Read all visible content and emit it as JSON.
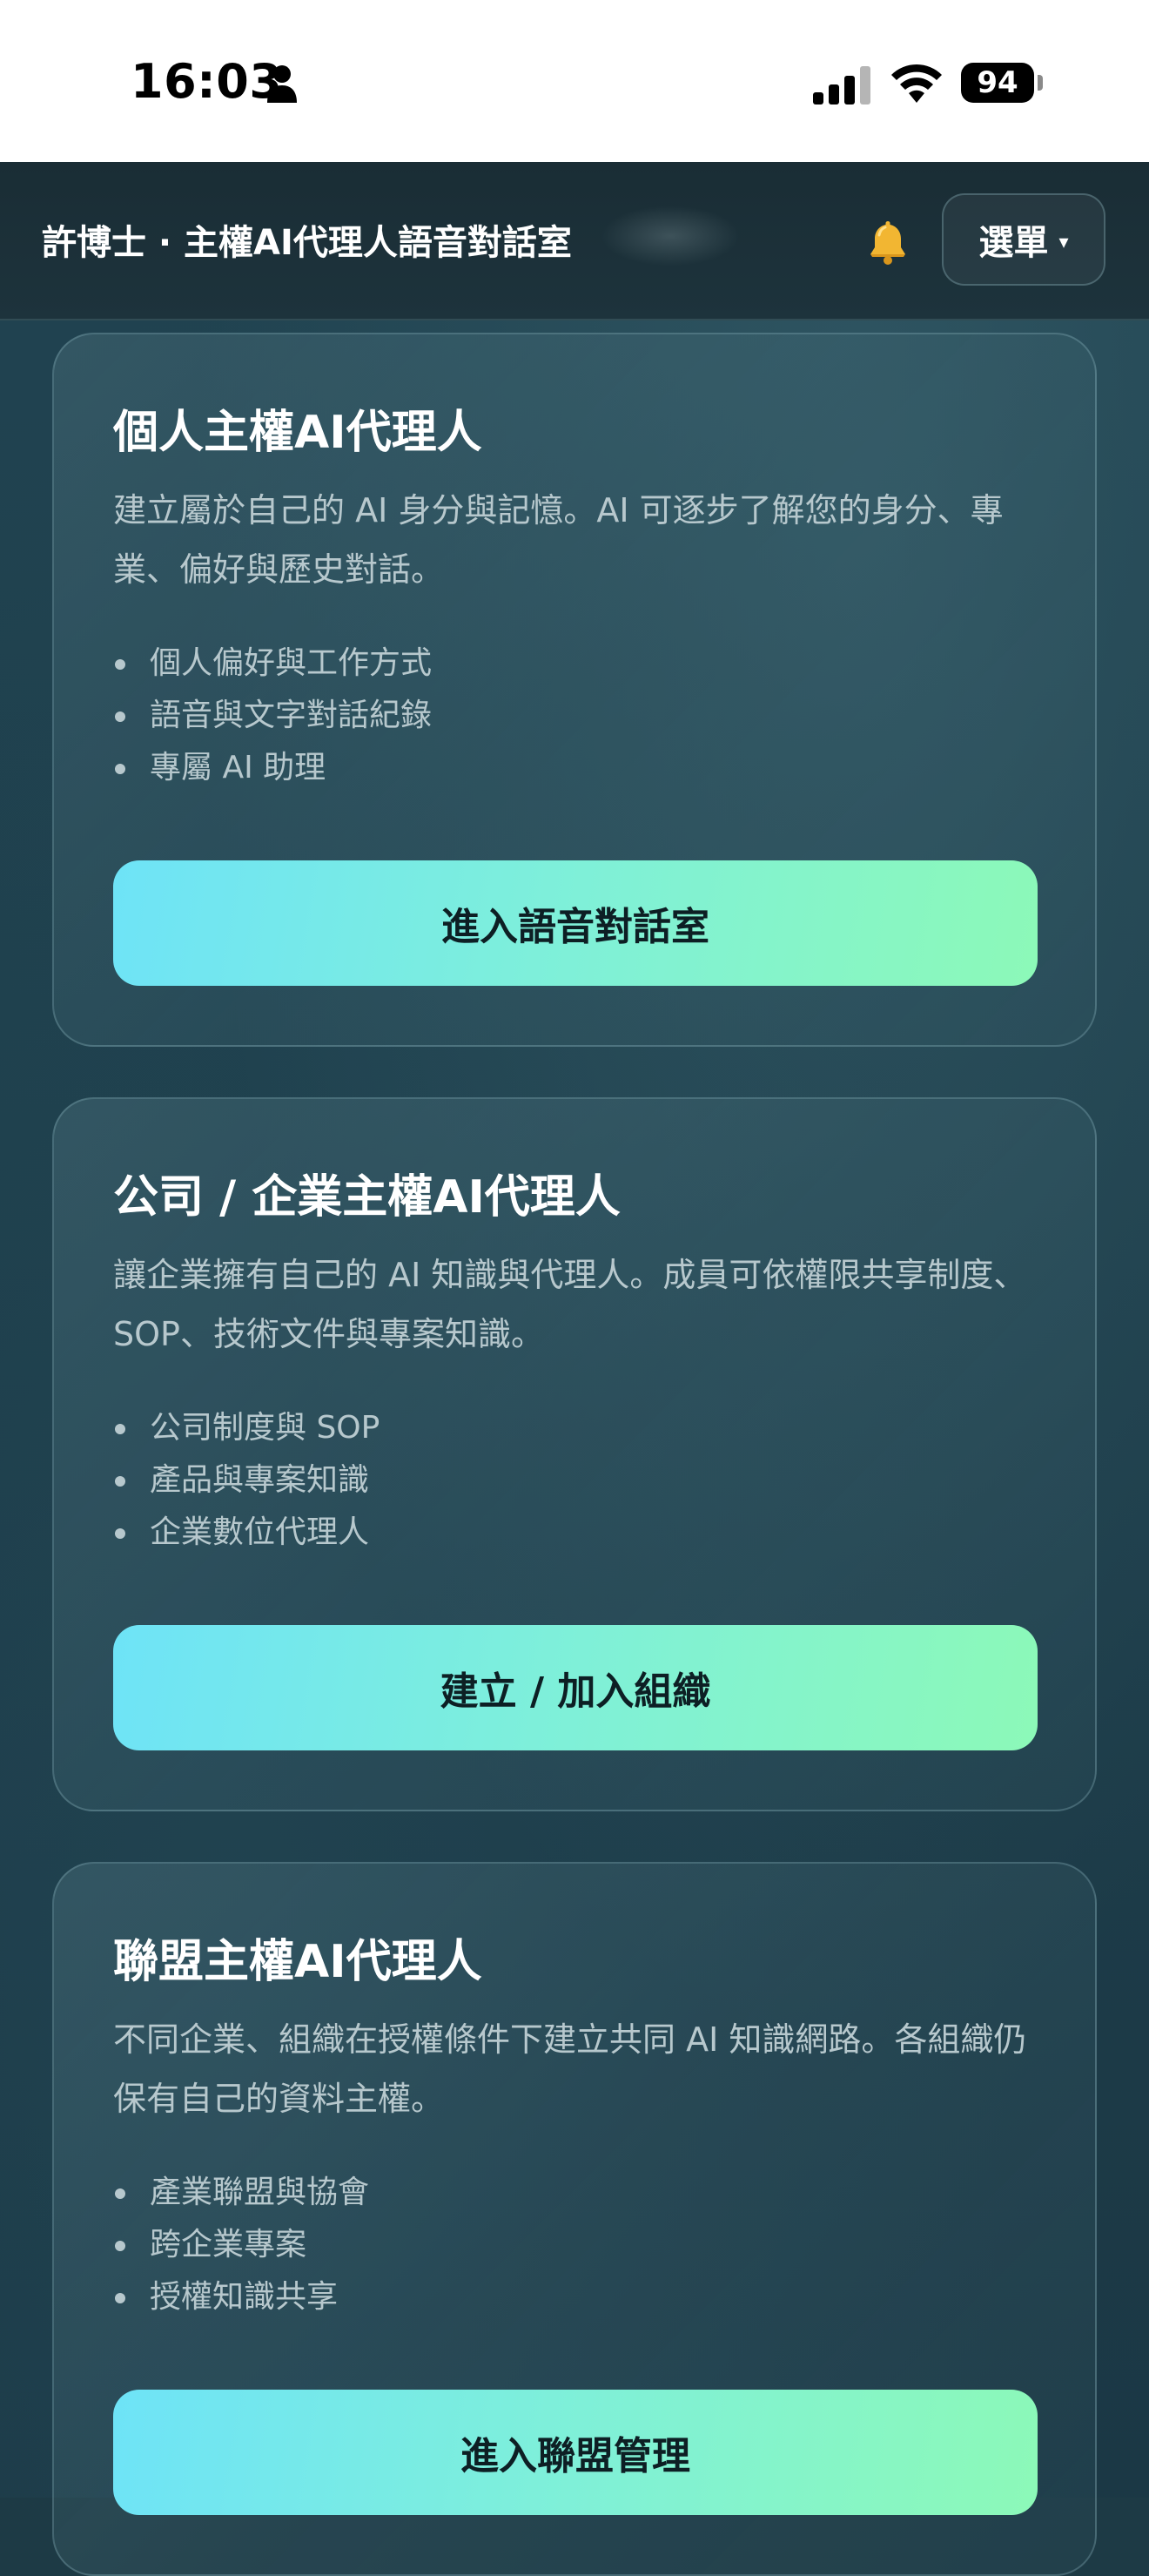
{
  "status_bar": {
    "time": "16:03",
    "battery": "94",
    "icons": [
      "person-icon",
      "signal-icon",
      "wifi-icon",
      "battery-icon"
    ]
  },
  "header": {
    "title": "許博士 · 主權AI代理人語音對話室",
    "bell_icon": "🔔",
    "menu_label": "選單",
    "menu_caret": "▾"
  },
  "cards": [
    {
      "title": "個人主權AI代理人",
      "description": "建立屬於自己的 AI 身分與記憶。AI 可逐步了解您的身分、專業、偏好與歷史對話。",
      "bullets": [
        "個人偏好與工作方式",
        "語音與文字對話紀錄",
        "專屬 AI 助理"
      ],
      "button": "進入語音對話室"
    },
    {
      "title": "公司 / 企業主權AI代理人",
      "description": "讓企業擁有自己的 AI 知識與代理人。成員可依權限共享制度、SOP、技術文件與專案知識。",
      "bullets": [
        "公司制度與 SOP",
        "產品與專案知識",
        "企業數位代理人"
      ],
      "button": "建立 / 加入組織"
    },
    {
      "title": "聯盟主權AI代理人",
      "description": "不同企業、組織在授權條件下建立共同 AI 知識網路。各組織仍保有自己的資料主權。",
      "bullets": [
        "產業聯盟與協會",
        "跨企業專案",
        "授權知識共享"
      ],
      "button": "進入聯盟管理"
    }
  ]
}
